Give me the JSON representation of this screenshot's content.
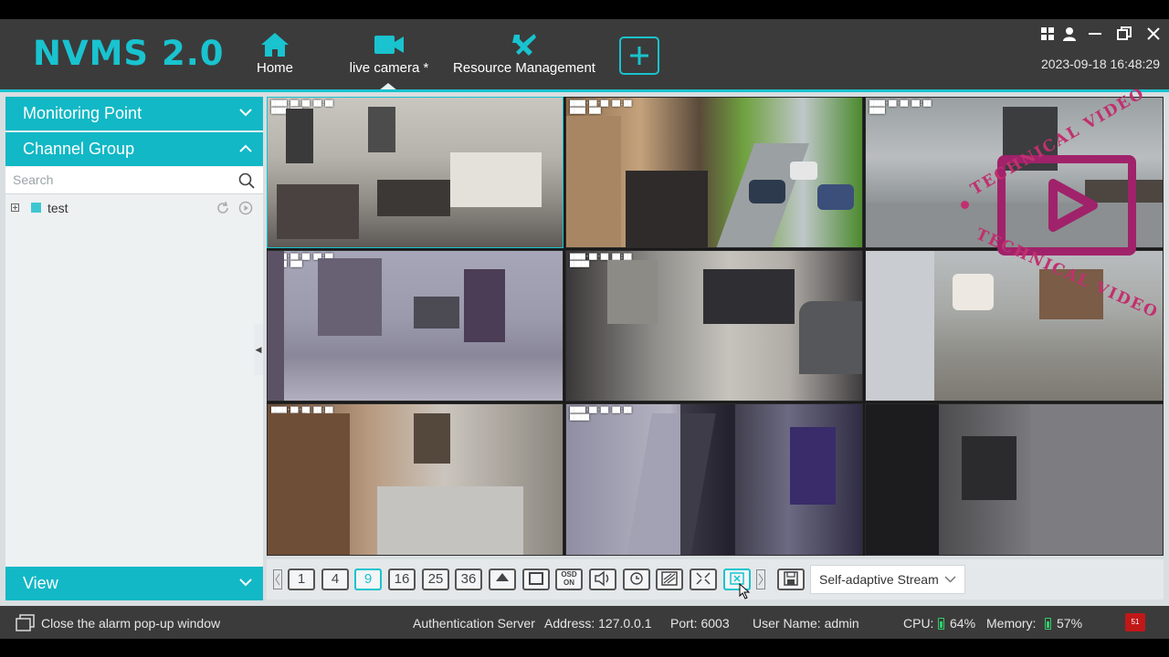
{
  "app": {
    "title": "NVMS 2.0"
  },
  "nav": [
    {
      "label": "Home",
      "icon": "home-icon"
    },
    {
      "label": "live camera *",
      "icon": "video-camera-icon"
    },
    {
      "label": "Resource Management",
      "icon": "tools-icon"
    }
  ],
  "header": {
    "datetime": "2023-09-18 16:48:29",
    "add_icon": "plus-icon"
  },
  "sidebar": {
    "monitoring_point": "Monitoring Point",
    "channel_group": "Channel Group",
    "search_placeholder": "Search",
    "tree": [
      {
        "label": "test"
      }
    ],
    "view": "View"
  },
  "video_grid": {
    "layout": "3x3",
    "selected_index": 0
  },
  "watermark": {
    "top_text": "TECHNICAL VIDEO",
    "bottom_text": "TECHNICAL VIDEO"
  },
  "toolbar": {
    "layouts": [
      "1",
      "4",
      "9",
      "16",
      "25",
      "36"
    ],
    "active_layout": "9",
    "osd_label": "OSD ON",
    "stream": "Self-adaptive Stream"
  },
  "status": {
    "close_alarm": "Close the alarm pop-up window",
    "auth_server": "Authentication Server",
    "address": "Address: 127.0.0.1",
    "port": "Port: 6003",
    "user": "User Name: admin",
    "cpu_label": "CPU:",
    "cpu": "64%",
    "memory_label": "Memory:",
    "memory": "57%",
    "alarm_count": "51"
  },
  "colors": {
    "accent": "#19c3cf",
    "header_bg": "#3b3b3b",
    "sidebar_head": "#12b8c6",
    "watermark": "#a0226a",
    "alarm": "#c01818"
  }
}
